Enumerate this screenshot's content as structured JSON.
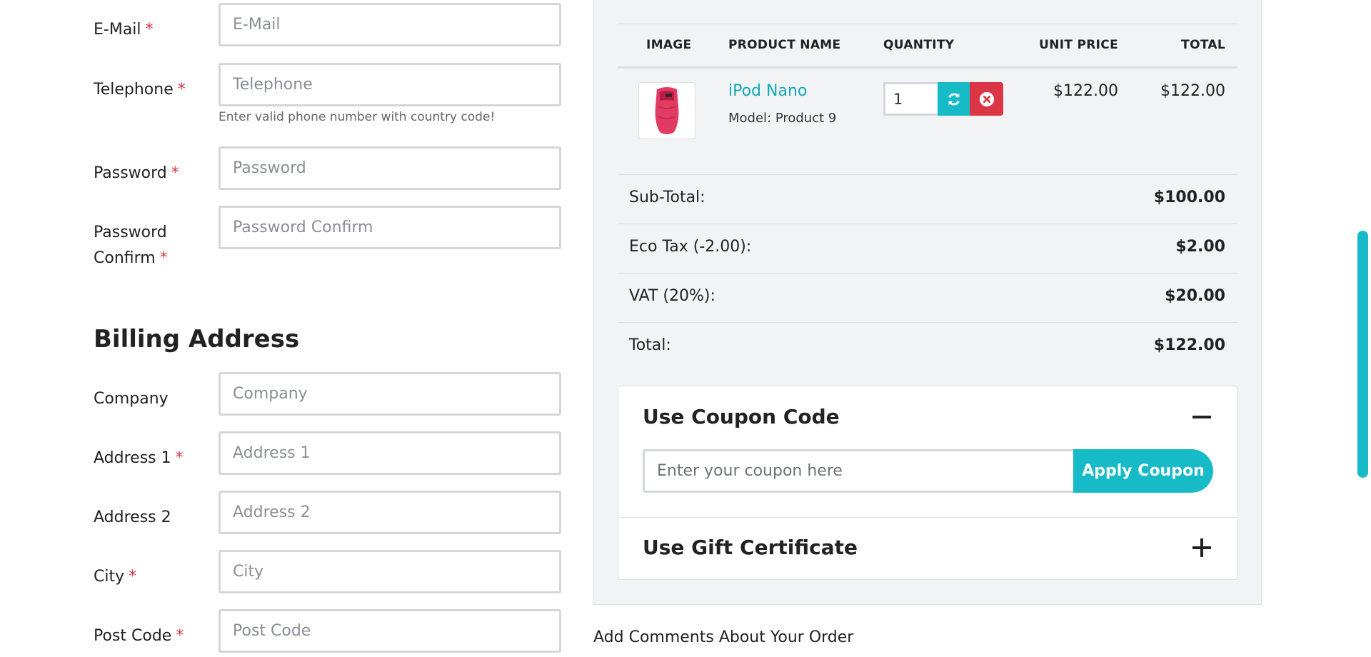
{
  "form": {
    "fields": [
      {
        "label": "E-Mail",
        "required": true,
        "placeholder": "E-Mail"
      },
      {
        "label": "Telephone",
        "required": true,
        "placeholder": "Telephone",
        "help": "Enter valid phone number with country code!"
      },
      {
        "label": "Password",
        "required": true,
        "placeholder": "Password"
      },
      {
        "label": "Password Confirm",
        "required": true,
        "placeholder": "Password Confirm"
      }
    ],
    "required_mark": "*",
    "billing_title": "Billing Address",
    "billing_fields": [
      {
        "label": "Company",
        "required": false,
        "placeholder": "Company"
      },
      {
        "label": "Address 1",
        "required": true,
        "placeholder": "Address 1"
      },
      {
        "label": "Address 2",
        "required": false,
        "placeholder": "Address 2"
      },
      {
        "label": "City",
        "required": true,
        "placeholder": "City"
      },
      {
        "label": "Post Code",
        "required": true,
        "placeholder": "Post Code"
      }
    ]
  },
  "cart": {
    "headers": {
      "image": "IMAGE",
      "product_name": "PRODUCT NAME",
      "quantity": "QUANTITY",
      "unit_price": "UNIT PRICE",
      "total": "TOTAL"
    },
    "items": [
      {
        "name": "iPod Nano",
        "model": "Model: Product 9",
        "quantity": "1",
        "unit_price": "$122.00",
        "total": "$122.00"
      }
    ],
    "summary": [
      {
        "label": "Sub-Total:",
        "value": "$100.00"
      },
      {
        "label": "Eco Tax (-2.00):",
        "value": "$2.00"
      },
      {
        "label": "VAT (20%):",
        "value": "$20.00"
      },
      {
        "label": "Total:",
        "value": "$122.00"
      }
    ]
  },
  "coupon": {
    "title": "Use Coupon Code",
    "placeholder": "Enter your coupon here",
    "button": "Apply Coupon"
  },
  "gift": {
    "title": "Use Gift Certificate"
  },
  "comments_label": "Add Comments About Your Order",
  "colors": {
    "accent": "#17bbc8",
    "danger": "#dc3545",
    "link": "#0fa9b8"
  }
}
